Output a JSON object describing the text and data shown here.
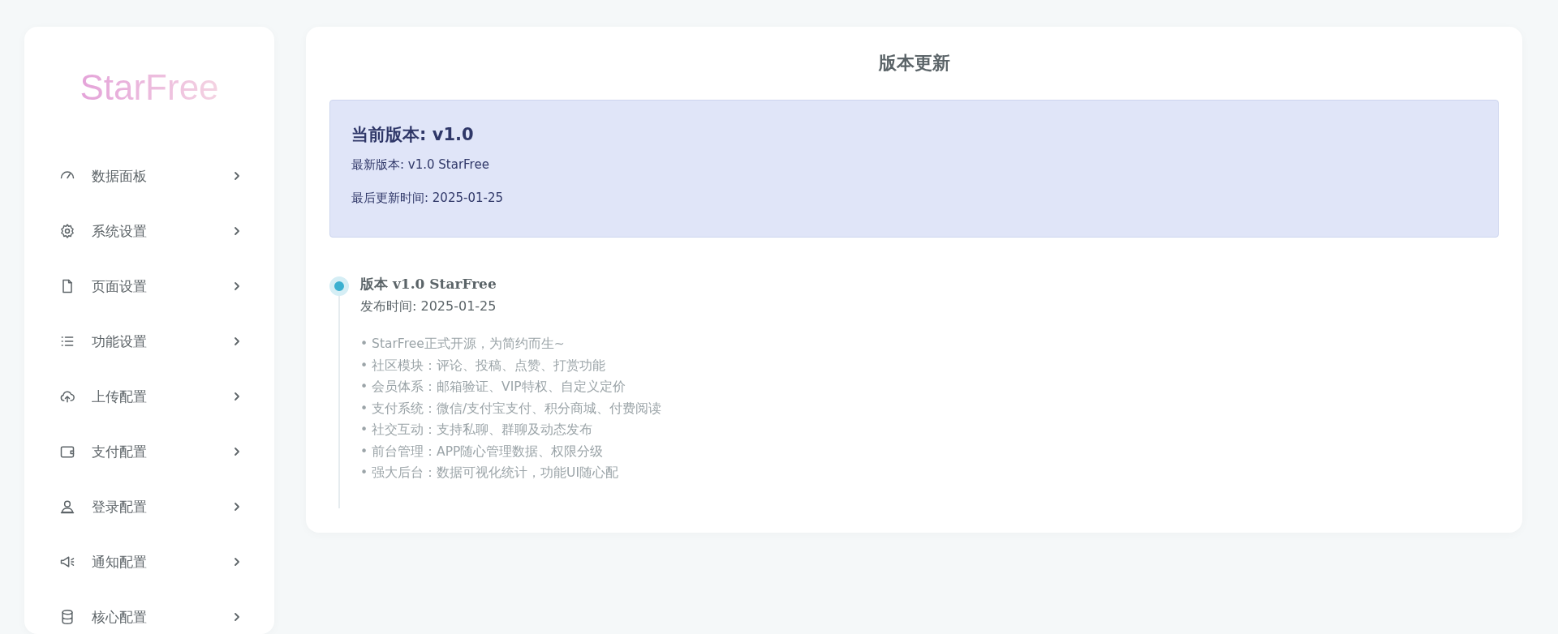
{
  "sidebar": {
    "logo": "StarFree",
    "items": [
      {
        "label": "数据面板",
        "expanded": false
      },
      {
        "label": "系统设置",
        "expanded": false
      },
      {
        "label": "页面设置",
        "expanded": false
      },
      {
        "label": "功能设置",
        "expanded": false
      },
      {
        "label": "上传配置",
        "expanded": false
      },
      {
        "label": "支付配置",
        "expanded": false
      },
      {
        "label": "登录配置",
        "expanded": false
      },
      {
        "label": "通知配置",
        "expanded": false
      },
      {
        "label": "核心配置",
        "expanded": false
      }
    ]
  },
  "main": {
    "title": "版本更新",
    "current": {
      "heading": "当前版本: v1.0",
      "latest": "最新版本: v1.0 StarFree",
      "updated": "最后更新时间: 2025-01-25"
    },
    "timeline": [
      {
        "title": "版本 v1.0 StarFree",
        "date": "发布时间: 2025-01-25",
        "notes": [
          "• StarFree正式开源，为简约而生~",
          "• 社区模块：评论、投稿、点赞、打赏功能",
          "• 会员体系：邮箱验证、VIP特权、自定义定价",
          "• 支付系统：微信/支付宝支付、积分商城、付费阅读",
          "• 社交互动：支持私聊、群聊及动态发布",
          "• 前台管理：APP随心管理数据、权限分级",
          "• 强大后台：数据可视化统计，功能UI随心配"
        ]
      }
    ]
  }
}
